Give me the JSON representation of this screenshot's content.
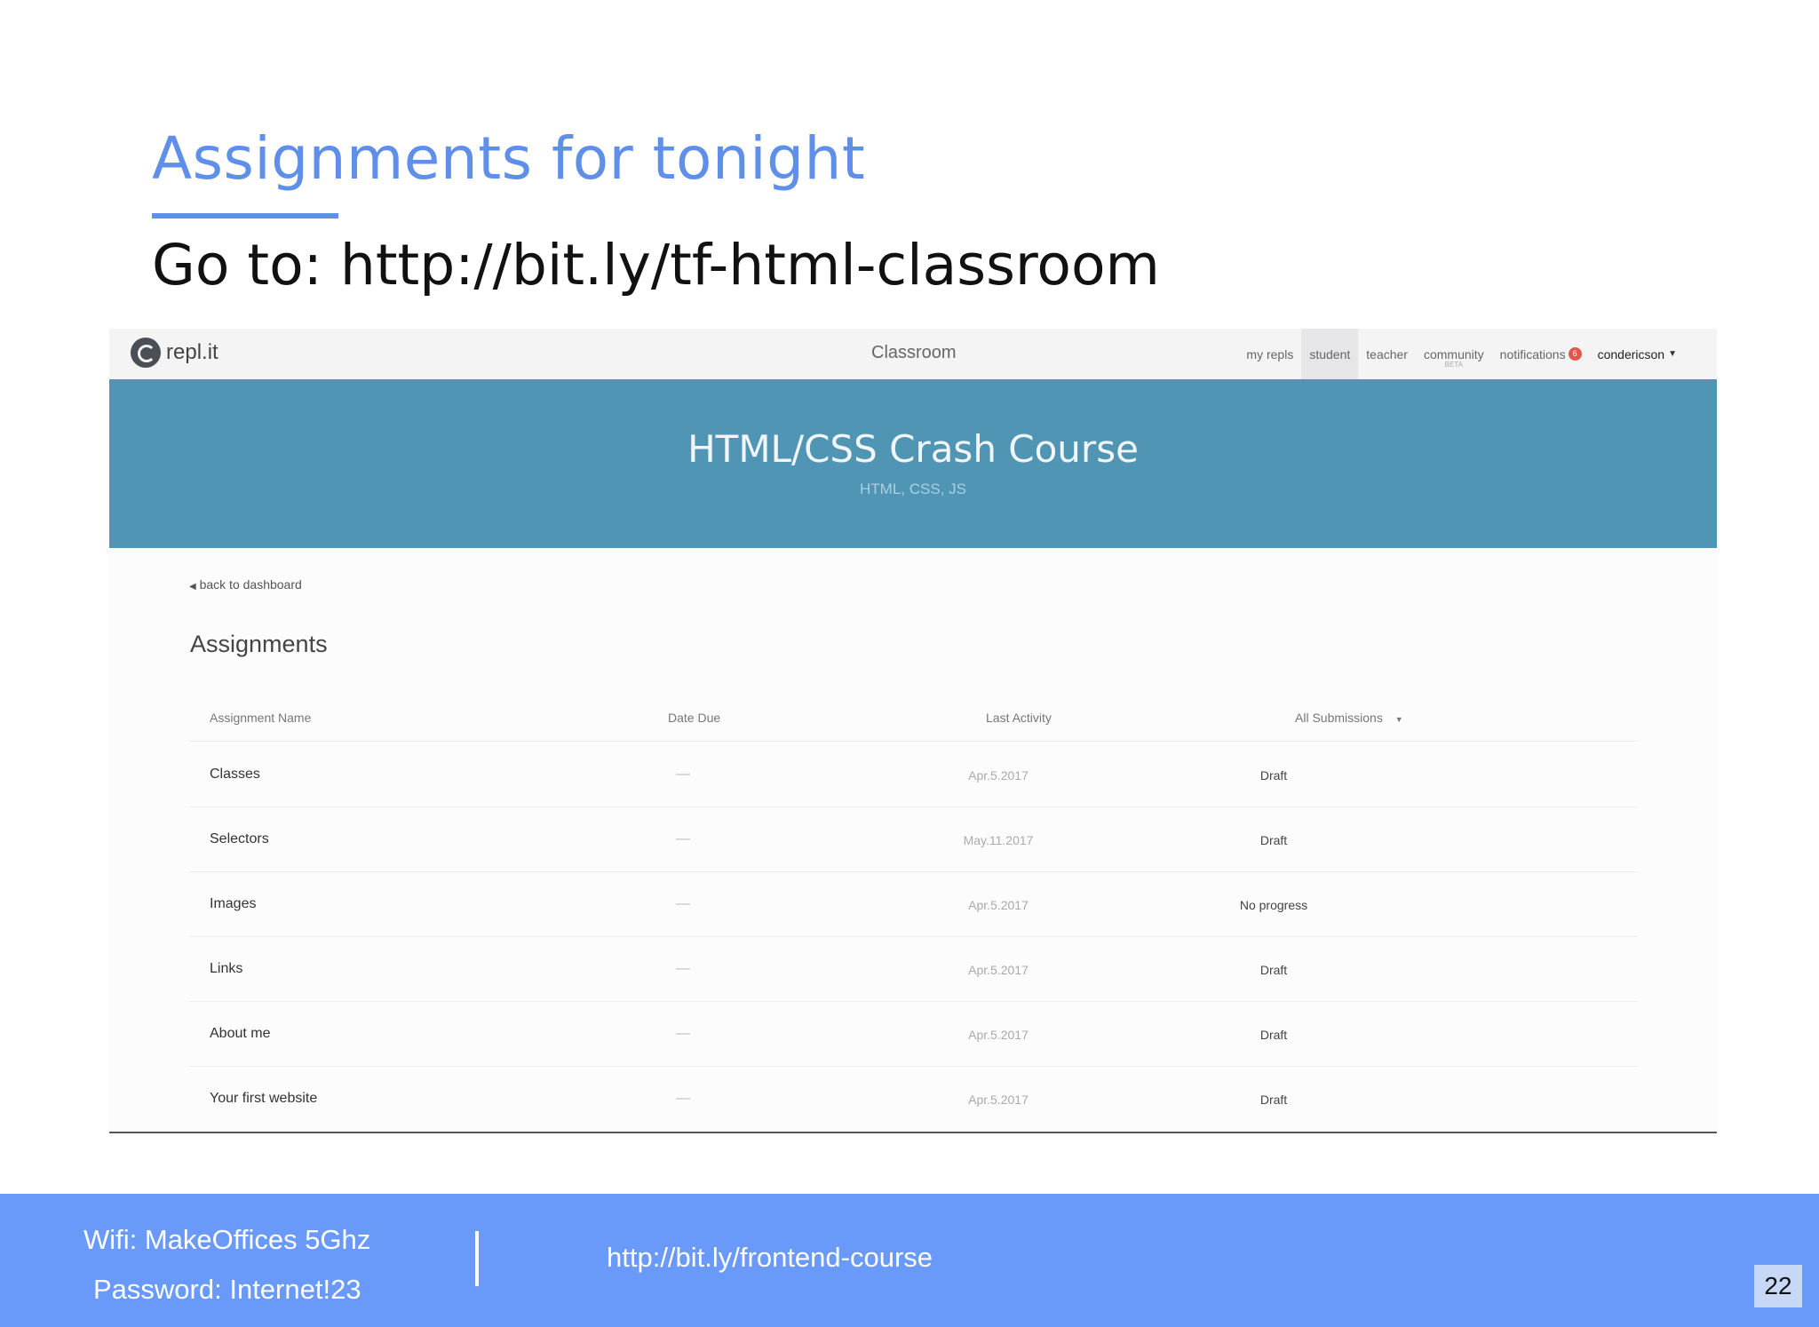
{
  "slide": {
    "title": "Assignments for tonight",
    "subtitle": "Go to: http://bit.ly/tf-html-classroom",
    "accent_color": "#5f8fe8"
  },
  "app": {
    "logo_text": "repl.it",
    "logo_icon": "repl-logo-icon",
    "title": "Classroom",
    "nav": [
      {
        "label": "my repls"
      },
      {
        "label": "student",
        "active": true
      },
      {
        "label": "teacher"
      },
      {
        "label": "community",
        "badge": "BETA"
      },
      {
        "label": "notifications",
        "count": "6"
      },
      {
        "label": "condericson"
      }
    ]
  },
  "banner": {
    "title": "HTML/CSS Crash Course",
    "tags": "HTML, CSS, JS",
    "color": "#5195b4"
  },
  "page": {
    "back_link": "back to dashboard",
    "heading": "Assignments"
  },
  "table": {
    "columns": [
      "Assignment Name",
      "Date Due",
      "Last Activity",
      "All Submissions"
    ],
    "rows": [
      {
        "name": "Classes",
        "due": "—",
        "activity": "Apr.5.2017",
        "status": "Draft"
      },
      {
        "name": "Selectors",
        "due": "—",
        "activity": "May.11.2017",
        "status": "Draft"
      },
      {
        "name": "Images",
        "due": "—",
        "activity": "Apr.5.2017",
        "status": "No progress"
      },
      {
        "name": "Links",
        "due": "—",
        "activity": "Apr.5.2017",
        "status": "Draft"
      },
      {
        "name": "About me",
        "due": "—",
        "activity": "Apr.5.2017",
        "status": "Draft"
      },
      {
        "name": "Your first website",
        "due": "—",
        "activity": "Apr.5.2017",
        "status": "Draft"
      }
    ]
  },
  "footer": {
    "wifi": "Wifi: MakeOffices 5Ghz",
    "password": "Password: Internet!23",
    "course_url": "http://bit.ly/frontend-course",
    "page_number": "22",
    "color": "#6999f9"
  }
}
